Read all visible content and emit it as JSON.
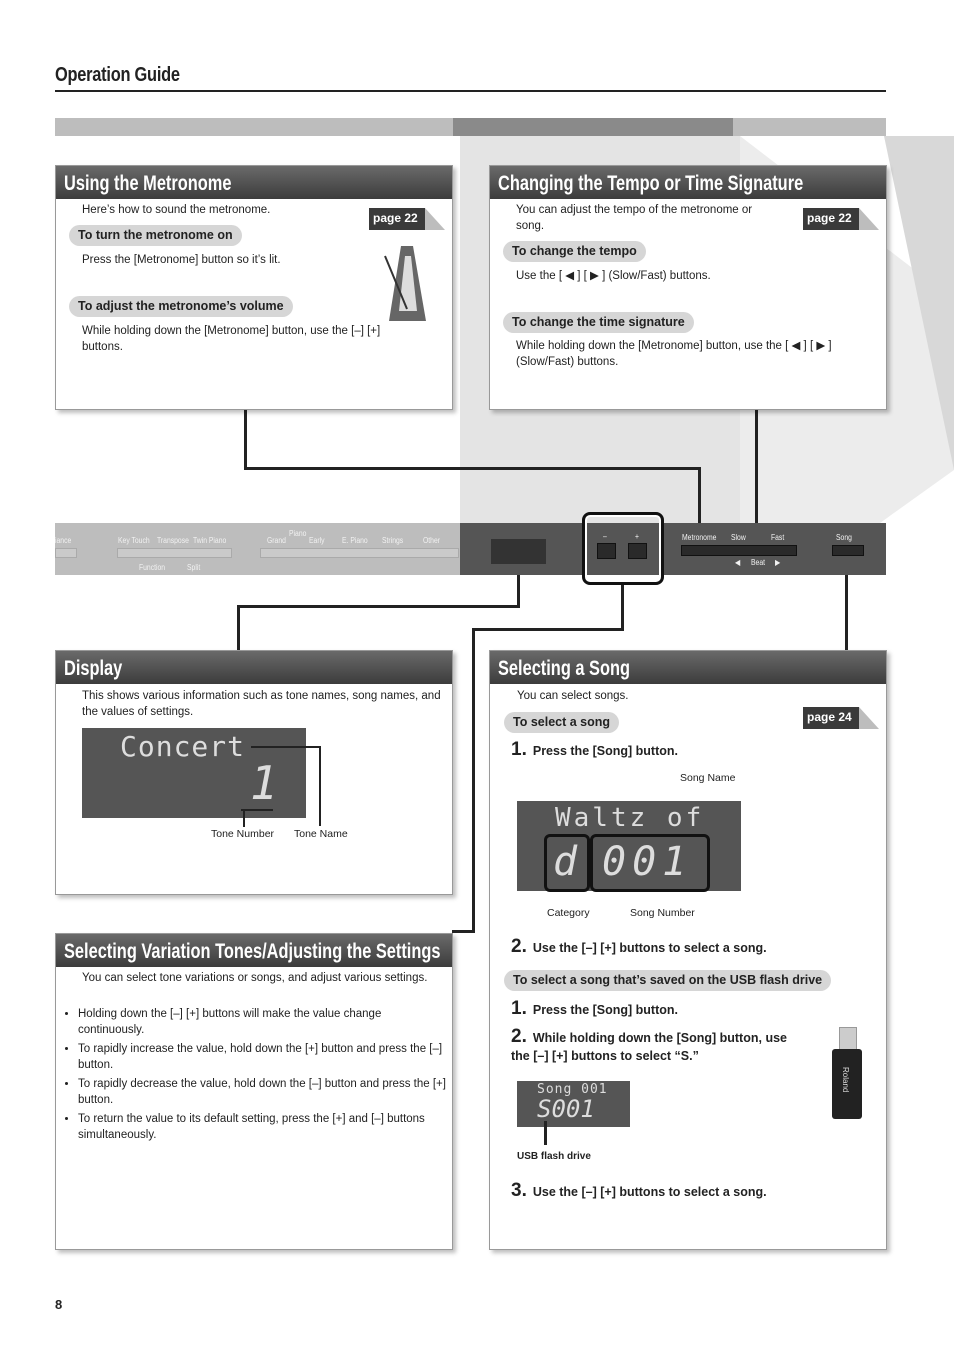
{
  "header": {
    "title": "Operation Guide"
  },
  "metronome": {
    "title": "Using the Metronome",
    "intro": "Here’s how to sound the metronome.",
    "page_ref": "page 22",
    "sub1": "To turn the metronome on",
    "text1": "Press the [Metronome] button so it’s lit.",
    "sub2": "To adjust the metronome’s volume",
    "text2": "While holding down the [Metronome] button, use the [–] [+] buttons."
  },
  "tempo": {
    "title": "Changing the Tempo or Time Signature",
    "intro": "You can adjust the tempo of the metronome or song.",
    "page_ref": "page 22",
    "sub1": "To change the tempo",
    "text1": "Use the [ ◀ ] [ ▶ ] (Slow/Fast) buttons.",
    "sub2": "To change the time signature",
    "text2": "While holding down the [Metronome] button, use the [ ◀ ] [ ▶ ] (Slow/Fast) buttons."
  },
  "panel": {
    "labels": [
      "iance",
      "Key Touch",
      "Transpose",
      "Twin Piano",
      "Piano",
      "Grand",
      "Early",
      "E. Piano",
      "Strings",
      "Other",
      "Function",
      "Split",
      "–",
      "+",
      "Metronome",
      "Slow",
      "Fast",
      "Song",
      "◀",
      "Beat",
      "▶"
    ]
  },
  "display": {
    "title": "Display",
    "intro": "This shows various information such as tone names, song names, and the values of settings.",
    "lcd_top": "Concert",
    "lcd_bottom": "1",
    "tone_number": "Tone Number",
    "tone_name": "Tone Name"
  },
  "song": {
    "title": "Selecting a Song",
    "intro": "You can select songs.",
    "page_ref": "page 24",
    "sub1": "To select a song",
    "step1": "Press the [Song] button.",
    "song_name": "Song Name",
    "lcd_top": "Waltz of",
    "lcd_cat": "d",
    "lcd_num": "001",
    "category": "Category",
    "song_number": "Song Number",
    "step2": "Use the [–] [+] buttons to select a song.",
    "sub2": "To select a song that’s saved on the USB flash drive",
    "usb_step1": "Press the [Song] button.",
    "usb_step2": "While holding down the [Song] button, use the [–] [+] buttons to select “S.”",
    "usb_lcd_top": "Song 001",
    "usb_lcd_bottom": "S001",
    "usb_label": "USB flash drive",
    "usb_brand": "Roland",
    "usb_step3": "Use the [–] [+] buttons to select a song."
  },
  "variation": {
    "title": "Selecting Variation Tones/Adjusting the Settings",
    "intro": "You can select tone variations or songs, and adjust various settings.",
    "bullets": [
      "Holding down the [–] [+] buttons will make the value change continuously.",
      "To rapidly increase the value, hold down the [+] button and press the [–] button.",
      "To rapidly decrease the value, hold down the [–] button and press the [+] button.",
      "To return the value to its default setting, press the [+] and [–] buttons simultaneously."
    ]
  },
  "footer": {
    "page_number": "8"
  }
}
